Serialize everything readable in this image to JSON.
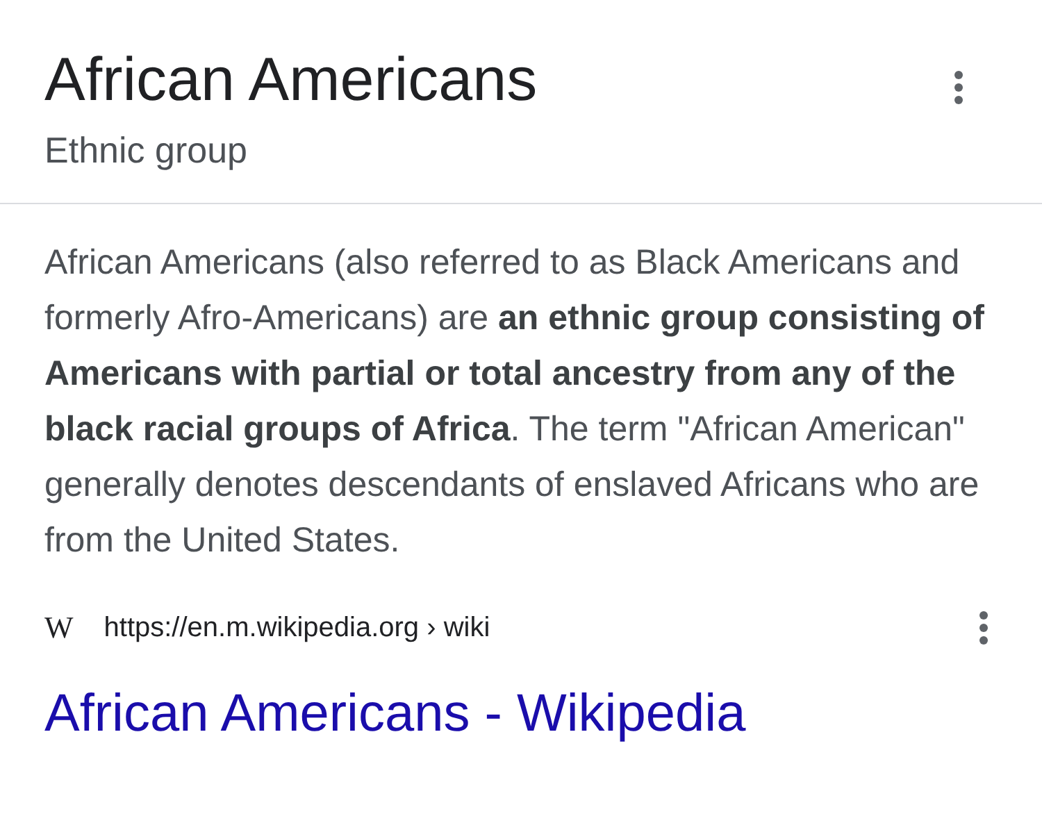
{
  "header": {
    "title": "African Americans",
    "subtitle": "Ethnic group"
  },
  "description": "African Americans (also referred to as Black Americans and formerly Afro-Americans) are **an ethnic group consisting of Americans with partial or total ancestry from any of the black racial groups of Africa**. The term \"African American\" generally denotes descendants of enslaved Africans who are from the United States.",
  "source": {
    "favicon": "W",
    "url": "https://en.m.wikipedia.org › wiki",
    "link": "African Americans - Wikipedia"
  }
}
